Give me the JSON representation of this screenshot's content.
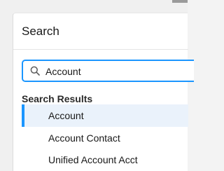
{
  "panel": {
    "title": "Search"
  },
  "search": {
    "value": "Account",
    "icon": "search-icon"
  },
  "results": {
    "heading": "Search Results",
    "items": [
      {
        "label": "Account",
        "selected": true
      },
      {
        "label": "Account Contact",
        "selected": false
      },
      {
        "label": "Unified Account Acct",
        "selected": false
      }
    ]
  },
  "colors": {
    "accent": "#1b96ff",
    "selected_bg": "#eaf2fb",
    "text": "#181818"
  }
}
